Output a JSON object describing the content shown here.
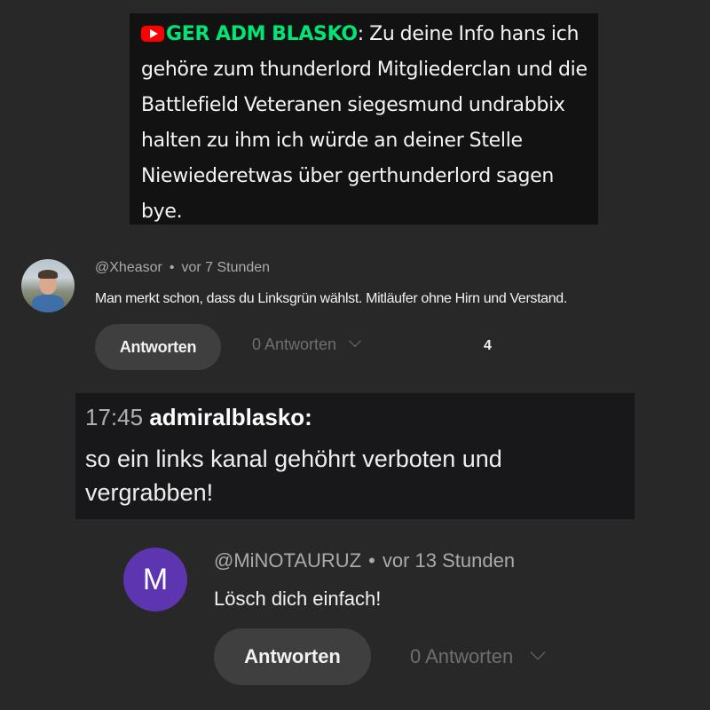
{
  "chat_overlay_top": {
    "icon": "youtube-icon",
    "username": "GER ADM BLASKO",
    "separator": ":",
    "message": " Zu deine Info hans ich gehöre zum thunderlord Mitgliederclan und die Battlefield Veteranen siegesmund undrabbix halten zu ihm ich würde an deiner Stelle Niewiederetwas über gerthunderlord sagen bye.",
    "colors": {
      "background": "#121212",
      "username": "#00e676",
      "icon": "#ff0000"
    }
  },
  "comment_1": {
    "avatar_icon": "profile-photo",
    "author": "@Xheasor",
    "separator": "•",
    "time": "vor 7 Stunden",
    "text": "Man merkt schon, dass du Linksgrün wählst. Mitläufer ohne Hirn und Verstand.",
    "reply_label": "Antworten",
    "replies_label": "0 Antworten",
    "likes": "4"
  },
  "chat_overlay_middle": {
    "time": "17:45",
    "username": "admiralblasko:",
    "message": "so ein links kanal gehöhrt verboten und vergrabben!",
    "colors": {
      "background": "#18181b"
    }
  },
  "comment_2": {
    "avatar_letter": "M",
    "author": "@MiNOTAURUZ",
    "separator": "•",
    "time": "vor 13 Stunden",
    "text": "Lösch dich einfach!",
    "reply_label": "Antworten",
    "replies_label": "0 Antworten",
    "colors": {
      "avatar": "#5e35b1"
    }
  },
  "theme": {
    "background": "#282828",
    "button": "#3f3f3f",
    "muted_text": "#aaaaaa"
  }
}
